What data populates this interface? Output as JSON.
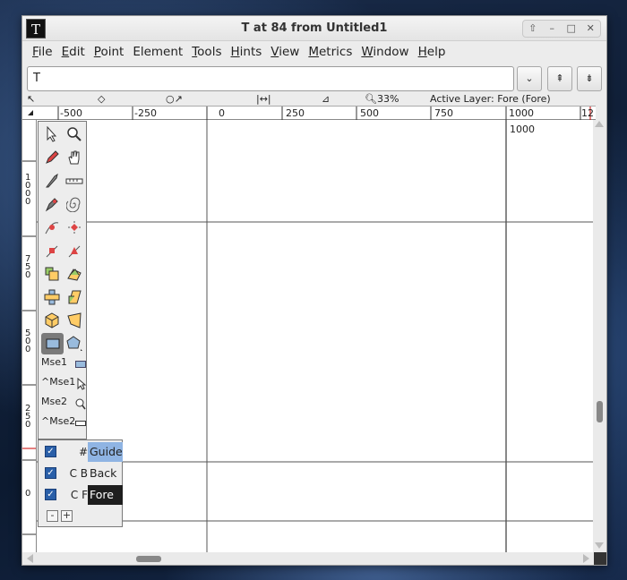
{
  "window": {
    "title": "T at 84 from Untitled1",
    "app_icon": "T",
    "buttons": [
      "up-arrow-icon",
      "minimize-icon",
      "maximize-icon",
      "close-icon"
    ]
  },
  "menubar": {
    "items": [
      {
        "label": "File",
        "mnemonic": "F",
        "rest": "ile"
      },
      {
        "label": "Edit",
        "mnemonic": "E",
        "rest": "dit"
      },
      {
        "label": "Point",
        "mnemonic": "P",
        "rest": "oint"
      },
      {
        "label": "Element",
        "mnemonic": "",
        "rest": "Element"
      },
      {
        "label": "Tools",
        "mnemonic": "T",
        "rest": "ools"
      },
      {
        "label": "Hints",
        "mnemonic": "H",
        "rest": "ints"
      },
      {
        "label": "View",
        "mnemonic": "V",
        "rest": "iew"
      },
      {
        "label": "Metrics",
        "mnemonic": "M",
        "rest": "etrics"
      },
      {
        "label": "Window",
        "mnemonic": "W",
        "rest": "indow"
      },
      {
        "label": "Help",
        "mnemonic": "H",
        "rest": "elp"
      }
    ]
  },
  "glyph_field": {
    "value": "T"
  },
  "status": {
    "zoom": "33%",
    "active_layer": "Active Layer: Fore (Fore)"
  },
  "ruler_top": {
    "ticks": [
      "-500",
      "-250",
      "0",
      "250",
      "500",
      "750",
      "1000",
      "12"
    ]
  },
  "ruler_left": {
    "ticks": [
      "1\n0\n0\n0",
      "7\n5\n0",
      "5\n0\n0",
      "2\n5\n0",
      "0",
      "2\n5"
    ]
  },
  "canvas": {
    "advance_label": "1000"
  },
  "toolbox": {
    "mouse": [
      {
        "label": "Mse1"
      },
      {
        "label": "^Mse1"
      },
      {
        "label": "Mse2"
      },
      {
        "label": "^Mse2"
      }
    ]
  },
  "layers": {
    "rows": [
      {
        "flags": "#",
        "name": "Guide",
        "checked": true
      },
      {
        "flags": "C B",
        "name": "Back",
        "checked": true
      },
      {
        "flags": "C F",
        "name": "Fore",
        "checked": true
      }
    ],
    "minus": "-",
    "plus": "+"
  },
  "colors": {
    "guide_highlight": "#8fb4e3",
    "fore_highlight": "#1e1e1e",
    "checkbox": "#2a5fa8"
  }
}
